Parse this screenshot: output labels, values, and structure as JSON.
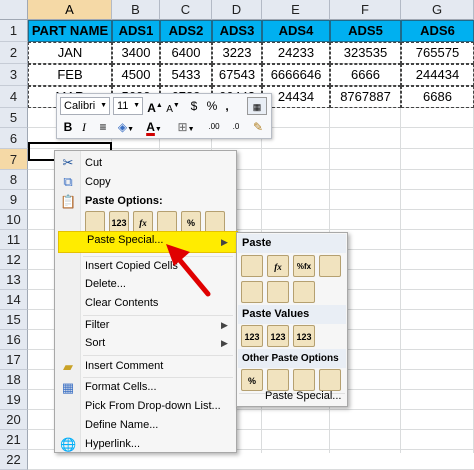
{
  "sheet": {
    "columns": [
      "A",
      "B",
      "C",
      "D",
      "E",
      "F",
      "G"
    ],
    "rows": [
      "1",
      "2",
      "3",
      "4",
      "5",
      "6",
      "7",
      "8",
      "9",
      "10",
      "11",
      "12",
      "13",
      "14",
      "15",
      "16",
      "17",
      "18",
      "19",
      "20",
      "21",
      "22"
    ],
    "header": [
      "PART NAME",
      "ADS1",
      "ADS2",
      "ADS3",
      "ADS4",
      "ADS5",
      "ADS6"
    ],
    "data": [
      [
        "JAN",
        "3400",
        "6400",
        "3223",
        "24233",
        "323535",
        "765575"
      ],
      [
        "FEB",
        "4500",
        "5433",
        "67543",
        "6666646",
        "6666",
        "244434"
      ],
      [
        "MAR",
        "5600",
        "6789",
        "66443",
        "24434",
        "8767887",
        "6686"
      ]
    ],
    "colors": {
      "header_fill": "#00b0f0",
      "selected_header": "#f5d9a6"
    }
  },
  "mini_toolbar": {
    "font_name": "Calibri",
    "font_size": "11",
    "grow_font": "A",
    "shrink_font": "A",
    "currency": "$",
    "percent": "%",
    "comma": ",",
    "bold": "B",
    "italic": "I",
    "increase_decimal": ".00",
    "decrease_decimal": ".0"
  },
  "context_menu": {
    "cut": "Cut",
    "copy": "Copy",
    "paste_options_title": "Paste Options:",
    "paste_special": "Paste Special...",
    "insert_copied_cells": "Insert Copied Cells",
    "delete": "Delete...",
    "clear_contents": "Clear Contents",
    "filter": "Filter",
    "sort": "Sort",
    "insert_comment": "Insert Comment",
    "format_cells": "Format Cells...",
    "pick_from_list": "Pick From Drop-down List...",
    "define_name": "Define Name...",
    "hyperlink": "Hyperlink...",
    "paste_icons": [
      "",
      "123",
      "fx",
      "",
      "%",
      ""
    ]
  },
  "paste_submenu": {
    "paste_title": "Paste",
    "paste_values_title": "Paste Values",
    "other_title": "Other Paste Options",
    "paste_special": "Paste Special...",
    "paste_icons": [
      "",
      "fx",
      "%fx",
      "",
      "",
      "",
      ""
    ],
    "values_icons": [
      "123",
      "123",
      "123"
    ],
    "other_icons": [
      "%",
      "",
      "",
      ""
    ]
  }
}
